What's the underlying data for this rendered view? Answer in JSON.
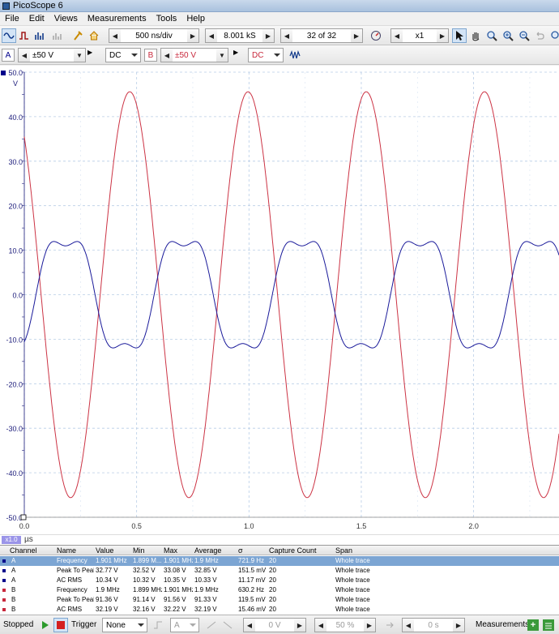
{
  "window": {
    "title": "PicoScope 6"
  },
  "menu": [
    "File",
    "Edit",
    "Views",
    "Measurements",
    "Tools",
    "Help"
  ],
  "toolbar": {
    "timebase": "500 ns/div",
    "samples": "8.001 kS",
    "buffer": "32 of 32",
    "zoom": "x1"
  },
  "channels": {
    "a": {
      "label": "A",
      "range": "±50 V",
      "coupling": "DC",
      "color": "#00008b"
    },
    "b": {
      "label": "B",
      "range": "±50 V",
      "coupling": "DC",
      "color": "#c8283c"
    }
  },
  "chart_data": {
    "type": "line",
    "ylabel": "V",
    "xlabel": "µs",
    "xlim": [
      0.0,
      2.38
    ],
    "ylim": [
      -50,
      50
    ],
    "y_ticks": [
      "50.0",
      "40.0",
      "30.0",
      "20.0",
      "10.0",
      "0.0",
      "-10.0",
      "-20.0",
      "-30.0",
      "-40.0",
      "-50.0"
    ],
    "x_ticks": [
      "0.0",
      "0.5",
      "1.0",
      "1.5",
      "2.0"
    ],
    "grid": true,
    "series": [
      {
        "name": "A",
        "color": "#1a1a9a",
        "frequency_mhz": 1.901,
        "peak": 16.2,
        "shape": "trapezoidal-sine"
      },
      {
        "name": "B",
        "color": "#cc3344",
        "frequency_mhz": 1.9,
        "amplitude": 45.6,
        "start_value": 35.5
      }
    ]
  },
  "unitbar": {
    "zoom": "x1.0",
    "unit": "µs"
  },
  "measurements": {
    "headers": [
      "Channel",
      "Name",
      "Value",
      "Min",
      "Max",
      "Average",
      "σ",
      "Capture Count",
      "Span"
    ],
    "rows": [
      [
        "A",
        "Frequency",
        "1.901 MHz",
        "1.899 M...",
        "1.901 MHz",
        "1.9 MHz",
        "721.9 Hz",
        "20",
        "Whole trace"
      ],
      [
        "A",
        "Peak To Peak",
        "32.77 V",
        "32.52 V",
        "33.08 V",
        "32.85 V",
        "151.5 mV",
        "20",
        "Whole trace"
      ],
      [
        "A",
        "AC RMS",
        "10.34 V",
        "10.32 V",
        "10.35 V",
        "10.33 V",
        "11.17 mV",
        "20",
        "Whole trace"
      ],
      [
        "B",
        "Frequency",
        "1.9 MHz",
        "1.899 MHz",
        "1.901 MHz",
        "1.9 MHz",
        "630.2 Hz",
        "20",
        "Whole trace"
      ],
      [
        "B",
        "Peak To Peak",
        "91.36 V",
        "91.14 V",
        "91.56 V",
        "91.33 V",
        "119.5 mV",
        "20",
        "Whole trace"
      ],
      [
        "B",
        "AC RMS",
        "32.19 V",
        "32.16 V",
        "32.22 V",
        "32.19 V",
        "15.46 mV",
        "20",
        "Whole trace"
      ]
    ]
  },
  "statusbar": {
    "state": "Stopped",
    "trigger_label": "Trigger",
    "trigger_mode": "None",
    "trigger_channel": "A",
    "threshold": "0 V",
    "percent": "50 %",
    "delay": "0 s",
    "measurements_label": "Measurements"
  }
}
